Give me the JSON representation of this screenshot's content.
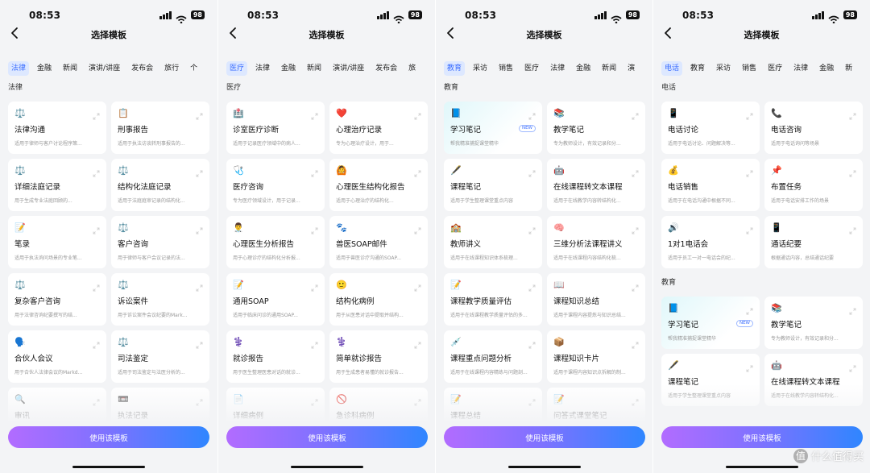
{
  "status": {
    "time": "08:53",
    "battery": "98"
  },
  "nav": {
    "title": "选择模板"
  },
  "cta_label": "使用该模板",
  "watermark": {
    "logo": "值",
    "text": "什么值得买"
  },
  "screens": [
    {
      "tabs": [
        "法律",
        "金融",
        "新闻",
        "演讲/讲座",
        "发布会",
        "旅行",
        "个"
      ],
      "active_tab": 0,
      "sections": [
        {
          "title": "法律",
          "cards": [
            {
              "icon": "⚖️",
              "name": "法律沟通",
              "desc": "适用于律师与客户讨论程序策..."
            },
            {
              "icon": "📋",
              "name": "刑事报告",
              "desc": "适用于执法访谈转刑事报告的..."
            },
            {
              "icon": "⚖️",
              "name": "详细法庭记录",
              "desc": "用于生成专业法庭回顾的..."
            },
            {
              "icon": "⚖️",
              "name": "结构化法庭记录",
              "desc": "适用于法庭庭审记录的结构化..."
            },
            {
              "icon": "📝",
              "name": "笔录",
              "desc": "适用于执法询问场景的专业笔..."
            },
            {
              "icon": "⚖️",
              "name": "客户咨询",
              "desc": "用于律师与客户会议记录的法..."
            },
            {
              "icon": "⚖️",
              "name": "复杂客户咨询",
              "desc": "用于法律咨询纪要撰写的结..."
            },
            {
              "icon": "⚖️",
              "name": "诉讼案件",
              "desc": "用于诉讼案件会议纪要的Mark..."
            },
            {
              "icon": "🗣️",
              "name": "合伙人会议",
              "desc": "用于合伙人法律会议的Markd..."
            },
            {
              "icon": "⚖️",
              "name": "司法鉴定",
              "desc": "适用于司法鉴定与法医分析的..."
            },
            {
              "icon": "🔍",
              "name": "审讯",
              "desc": ""
            },
            {
              "icon": "📼",
              "name": "执法记录",
              "desc": ""
            }
          ]
        }
      ]
    },
    {
      "tabs": [
        "医疗",
        "法律",
        "金融",
        "新闻",
        "演讲/讲座",
        "发布会",
        "旅"
      ],
      "active_tab": 0,
      "sections": [
        {
          "title": "医疗",
          "cards": [
            {
              "icon": "🏥",
              "name": "诊室医疗诊断",
              "desc": "适用于记录医疗领域中的病人..."
            },
            {
              "icon": "❤️",
              "name": "心理治疗记录",
              "desc": "专为心理治疗设计，用于..."
            },
            {
              "icon": "🩺",
              "name": "医疗咨询",
              "desc": "专为医疗领域设计，用于记录..."
            },
            {
              "icon": "🙆",
              "name": "心理医生结构化报告",
              "desc": "适用于心理治疗的结构化..."
            },
            {
              "icon": "👨‍⚕️",
              "name": "心理医生分析报告",
              "desc": "用于心理诊疗的结构化分析报..."
            },
            {
              "icon": "🐾",
              "name": "兽医SOAP邮件",
              "desc": "适用于兽医诊疗沟通的SOAP..."
            },
            {
              "icon": "📝",
              "name": "通用SOAP",
              "desc": "适用于临床问诊的通用SOAP..."
            },
            {
              "icon": "🙂",
              "name": "结构化病例",
              "desc": "用于从医患对话中提取并结构..."
            },
            {
              "icon": "⚕️",
              "name": "就诊报告",
              "desc": "用于医生整理医患对话的就诊..."
            },
            {
              "icon": "⚕️",
              "name": "简单就诊报告",
              "desc": "用于生成患者易懂的就诊报告..."
            },
            {
              "icon": "📄",
              "name": "详细病例",
              "desc": ""
            },
            {
              "icon": "🚫",
              "name": "急诊科病例",
              "desc": ""
            }
          ]
        }
      ]
    },
    {
      "tabs": [
        "教育",
        "采访",
        "销售",
        "医疗",
        "法律",
        "金融",
        "新闻",
        "演"
      ],
      "active_tab": 0,
      "sections": [
        {
          "title": "教育",
          "cards": [
            {
              "icon": "📘",
              "name": "学习笔记",
              "desc": "帮我精准捕捉课堂精华",
              "badge": "NEW",
              "highlight": true
            },
            {
              "icon": "📚",
              "name": "教学笔记",
              "desc": "专为教师设计，有效记录和分..."
            },
            {
              "icon": "🖋️",
              "name": "课程笔记",
              "desc": "适用于学生整理课堂重点内容"
            },
            {
              "icon": "🤖",
              "name": "在线课程转文本课程",
              "desc": "适用于在线教学内容转结构化..."
            },
            {
              "icon": "🏫",
              "name": "教师讲义",
              "desc": "适用于在线课程知识体系梳理..."
            },
            {
              "icon": "🧠",
              "name": "三维分析法课程讲义",
              "desc": "适用于在线课程内容结构化梳..."
            },
            {
              "icon": "📝",
              "name": "课程教学质量评估",
              "desc": "适用于在线课程教学质量评估的多..."
            },
            {
              "icon": "📖",
              "name": "课程知识总结",
              "desc": "适用于课程内容提炼与知识总结..."
            },
            {
              "icon": "💉",
              "name": "课程重点问题分析",
              "desc": "适用于在线课程内容精练与问题剖..."
            },
            {
              "icon": "📦",
              "name": "课程知识卡片",
              "desc": "适用于课程内容知识点拆解的制..."
            },
            {
              "icon": "📝",
              "name": "课程总结",
              "desc": ""
            },
            {
              "icon": "📝",
              "name": "问答式课堂笔记",
              "desc": ""
            }
          ]
        }
      ]
    },
    {
      "tabs": [
        "电话",
        "教育",
        "采访",
        "销售",
        "医疗",
        "法律",
        "金融",
        "新"
      ],
      "active_tab": 0,
      "sections": [
        {
          "title": "电话",
          "cards": [
            {
              "icon": "📱",
              "name": "电话讨论",
              "desc": "适用于电话讨论、问题解决等..."
            },
            {
              "icon": "📞",
              "name": "电话咨询",
              "desc": "适用于电话询问等场景"
            },
            {
              "icon": "💰",
              "name": "电话销售",
              "desc": "适用于在电话沟通中根据不同..."
            },
            {
              "icon": "📌",
              "name": "布置任务",
              "desc": "适用于电话安排工作的场景"
            },
            {
              "icon": "🔊",
              "name": "1对1电话会",
              "desc": "适用于员工一对一电话会的纪..."
            },
            {
              "icon": "📱",
              "name": "通话纪要",
              "desc": "根据通话内容，总结通话纪要"
            }
          ]
        },
        {
          "title": "教育",
          "cards": [
            {
              "icon": "📘",
              "name": "学习笔记",
              "desc": "帮我精准捕捉课堂精华",
              "badge": "NEW",
              "highlight": true
            },
            {
              "icon": "📚",
              "name": "教学笔记",
              "desc": "专为教师设计，有效记录和分..."
            },
            {
              "icon": "🖋️",
              "name": "课程笔记",
              "desc": "适用于学生整理课堂重点内容"
            },
            {
              "icon": "🤖",
              "name": "在线课程转文本课程",
              "desc": "适用于在线教学内容转结构化..."
            }
          ]
        }
      ]
    }
  ]
}
